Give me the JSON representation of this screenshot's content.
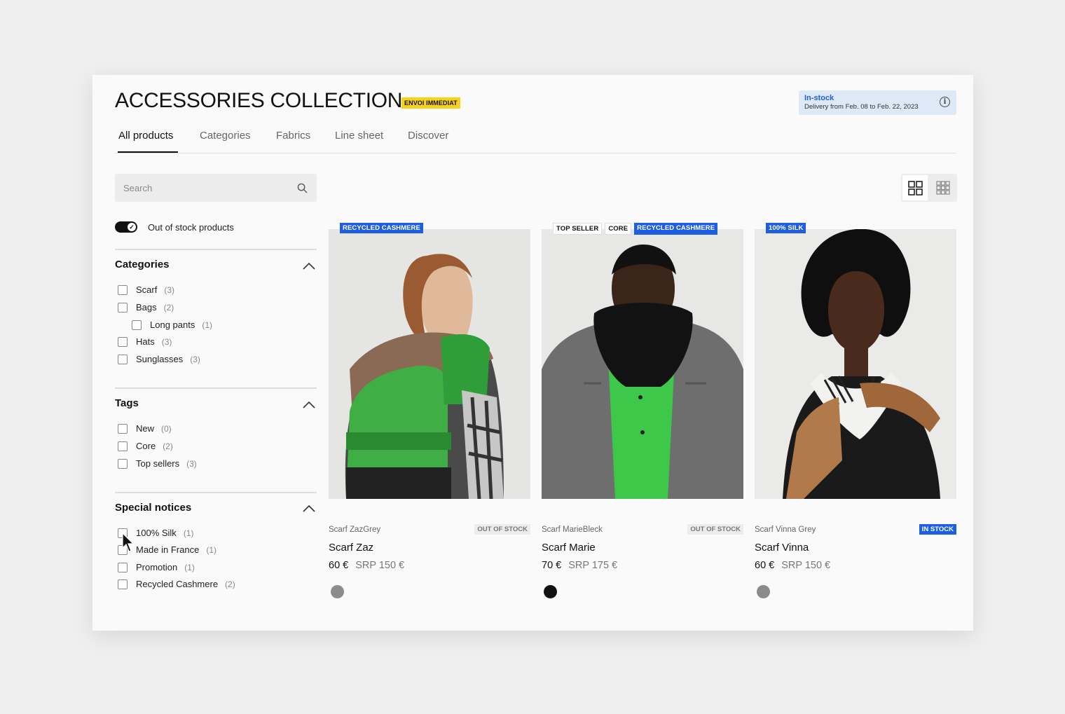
{
  "header": {
    "title": "ACCESSORIES COLLECTION",
    "badge": "ENVOI IMMEDIAT",
    "stock_title": "In-stock",
    "stock_sub": "Delivery from Feb. 08 to Feb. 22, 2023",
    "info_icon": "i"
  },
  "tabs": [
    {
      "label": "All products"
    },
    {
      "label": "Categories"
    },
    {
      "label": "Fabrics"
    },
    {
      "label": "Line sheet"
    },
    {
      "label": "Discover"
    }
  ],
  "search": {
    "placeholder": "Search"
  },
  "toggle": {
    "label": "Out of stock products",
    "on": true
  },
  "filters": {
    "categories": {
      "title": "Categories",
      "items": [
        {
          "label": "Scarf",
          "count": "(3)"
        },
        {
          "label": "Bags",
          "count": "(2)"
        },
        {
          "label": "Long pants",
          "count": "(1)"
        },
        {
          "label": "Hats",
          "count": "(3)"
        },
        {
          "label": "Sunglasses",
          "count": "(3)"
        }
      ]
    },
    "tags": {
      "title": "Tags",
      "items": [
        {
          "label": "New",
          "count": "(0)"
        },
        {
          "label": "Core",
          "count": "(2)"
        },
        {
          "label": "Top sellers",
          "count": "(3)"
        }
      ]
    },
    "special": {
      "title": "Special notices",
      "items": [
        {
          "label": "100% Silk",
          "count": "(1)"
        },
        {
          "label": "Made in France",
          "count": "(1)"
        },
        {
          "label": "Promotion",
          "count": "(1)"
        },
        {
          "label": "Recycled Cashmere",
          "count": "(2)"
        }
      ]
    }
  },
  "products": [
    {
      "tags": [
        "RECYCLED CASHMERE"
      ],
      "ref": "Scarf ZazGrey",
      "status": "OUT OF STOCK",
      "name": "Scarf Zaz",
      "price": "60 €",
      "srp": "SRP 150 €",
      "swatch": "#8c8c8c"
    },
    {
      "tags": [
        "TOP SELLER",
        "CORE",
        "RECYCLED CASHMERE"
      ],
      "ref": "Scarf MarieBleck",
      "status": "OUT OF STOCK",
      "name": "Scarf Marie",
      "price": "70 €",
      "srp": "SRP 175 €",
      "swatch": "#111111"
    },
    {
      "tags": [
        "100% SILK"
      ],
      "ref": "Scarf Vinna Grey",
      "status": "IN STOCK",
      "name": "Scarf Vinna",
      "price": "60 €",
      "srp": "SRP 150 €",
      "swatch": "#8a8a8a"
    }
  ],
  "colors": {
    "accent_blue": "#1d5fe0",
    "badge_yellow": "#f7d21a",
    "stock_bg": "#dde9f7"
  }
}
